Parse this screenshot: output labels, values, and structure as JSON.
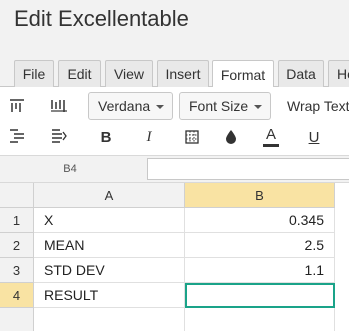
{
  "app": {
    "title": "Edit Excellentable"
  },
  "tabs": [
    {
      "label": "File"
    },
    {
      "label": "Edit"
    },
    {
      "label": "View"
    },
    {
      "label": "Insert"
    },
    {
      "label": "Format",
      "active": true
    },
    {
      "label": "Data"
    },
    {
      "label": "He"
    }
  ],
  "toolbar": {
    "font_family": "Verdana",
    "font_size": "Font Size",
    "wrap_text": "Wrap Text",
    "bold": "B",
    "italic": "I",
    "text_color_glyph": "A",
    "underline": "U",
    "icons": [
      "align-top-icon",
      "align-middle-icon",
      "indent-icon",
      "outdent-icon",
      "borders-icon",
      "fill-color-icon"
    ],
    "accent_color": "#1aa389"
  },
  "formula_bar": {
    "cell_ref": "B4",
    "value": ""
  },
  "grid": {
    "columns": [
      "A",
      "B"
    ],
    "selected_column": "B",
    "rows": [
      {
        "num": "1",
        "a": "X",
        "b": "0.345"
      },
      {
        "num": "2",
        "a": "MEAN",
        "b": "2.5"
      },
      {
        "num": "3",
        "a": "STD DEV",
        "b": "1.1"
      },
      {
        "num": "4",
        "a": "RESULT",
        "b": ""
      }
    ],
    "selected_row": "4",
    "selected_header_color": "#f9e3a3"
  }
}
